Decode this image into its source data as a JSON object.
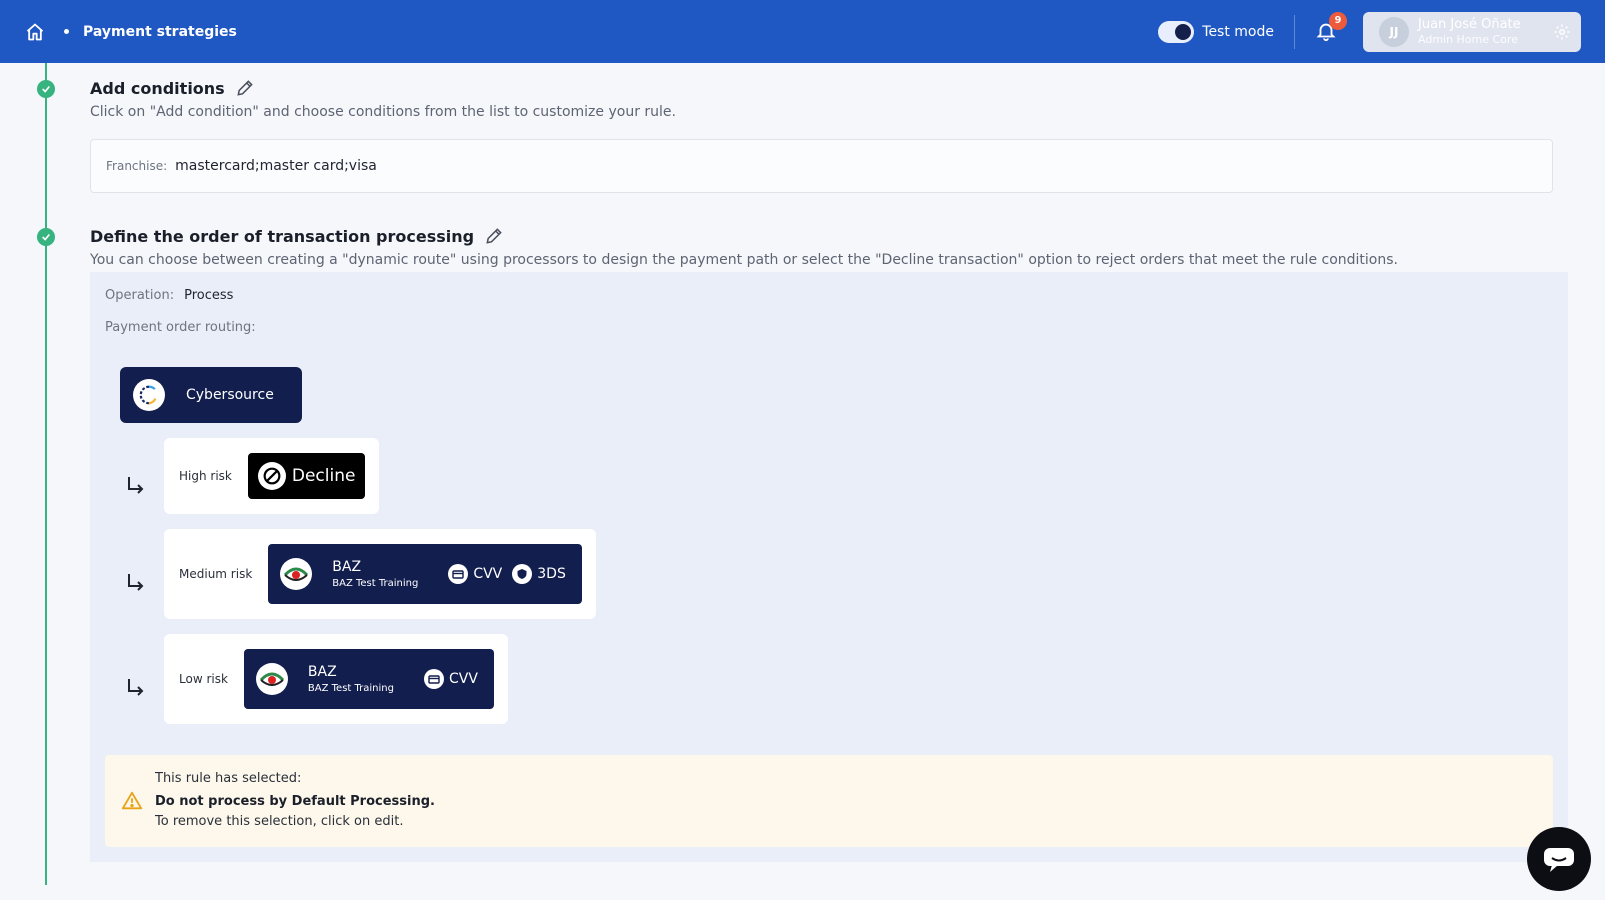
{
  "header": {
    "breadcrumb": "Payment strategies",
    "test_mode_label": "Test mode",
    "notifications_count": "9",
    "user": {
      "initials": "JJ",
      "name": "Juan José Oñate",
      "role": "Admin Home Core"
    }
  },
  "steps": [
    {
      "title": "Add conditions",
      "description": "Click on \"Add condition\" and choose conditions from the list to customize your rule.",
      "condition": {
        "label": "Franchise:",
        "value": "mastercard;master card;visa"
      }
    },
    {
      "title": "Define the order of transaction processing",
      "description": "You can choose between creating a \"dynamic route\" using processors to design the payment path or select the \"Decline transaction\" option to reject orders that meet the rule conditions."
    }
  ],
  "routing": {
    "operation_label": "Operation:",
    "operation_value": "Process",
    "routing_label": "Payment order routing:",
    "processor": "Cybersource",
    "risks": [
      {
        "label": "High risk",
        "action": "Decline"
      },
      {
        "label": "Medium risk",
        "processor": "BAZ",
        "processor_sub": "BAZ Test Training",
        "tags": [
          "CVV",
          "3DS"
        ]
      },
      {
        "label": "Low risk",
        "processor": "BAZ",
        "processor_sub": "BAZ Test Training",
        "tags": [
          "CVV"
        ]
      }
    ]
  },
  "alert": {
    "line1": "This rule has selected:",
    "line2": "Do not process by Default Processing.",
    "line3": "To remove this selection, click on edit."
  },
  "colors": {
    "header": "#1f57c3",
    "accent_green": "#36b37e",
    "processor_bg": "#121e4e",
    "panel_bg": "#e9eef8"
  }
}
